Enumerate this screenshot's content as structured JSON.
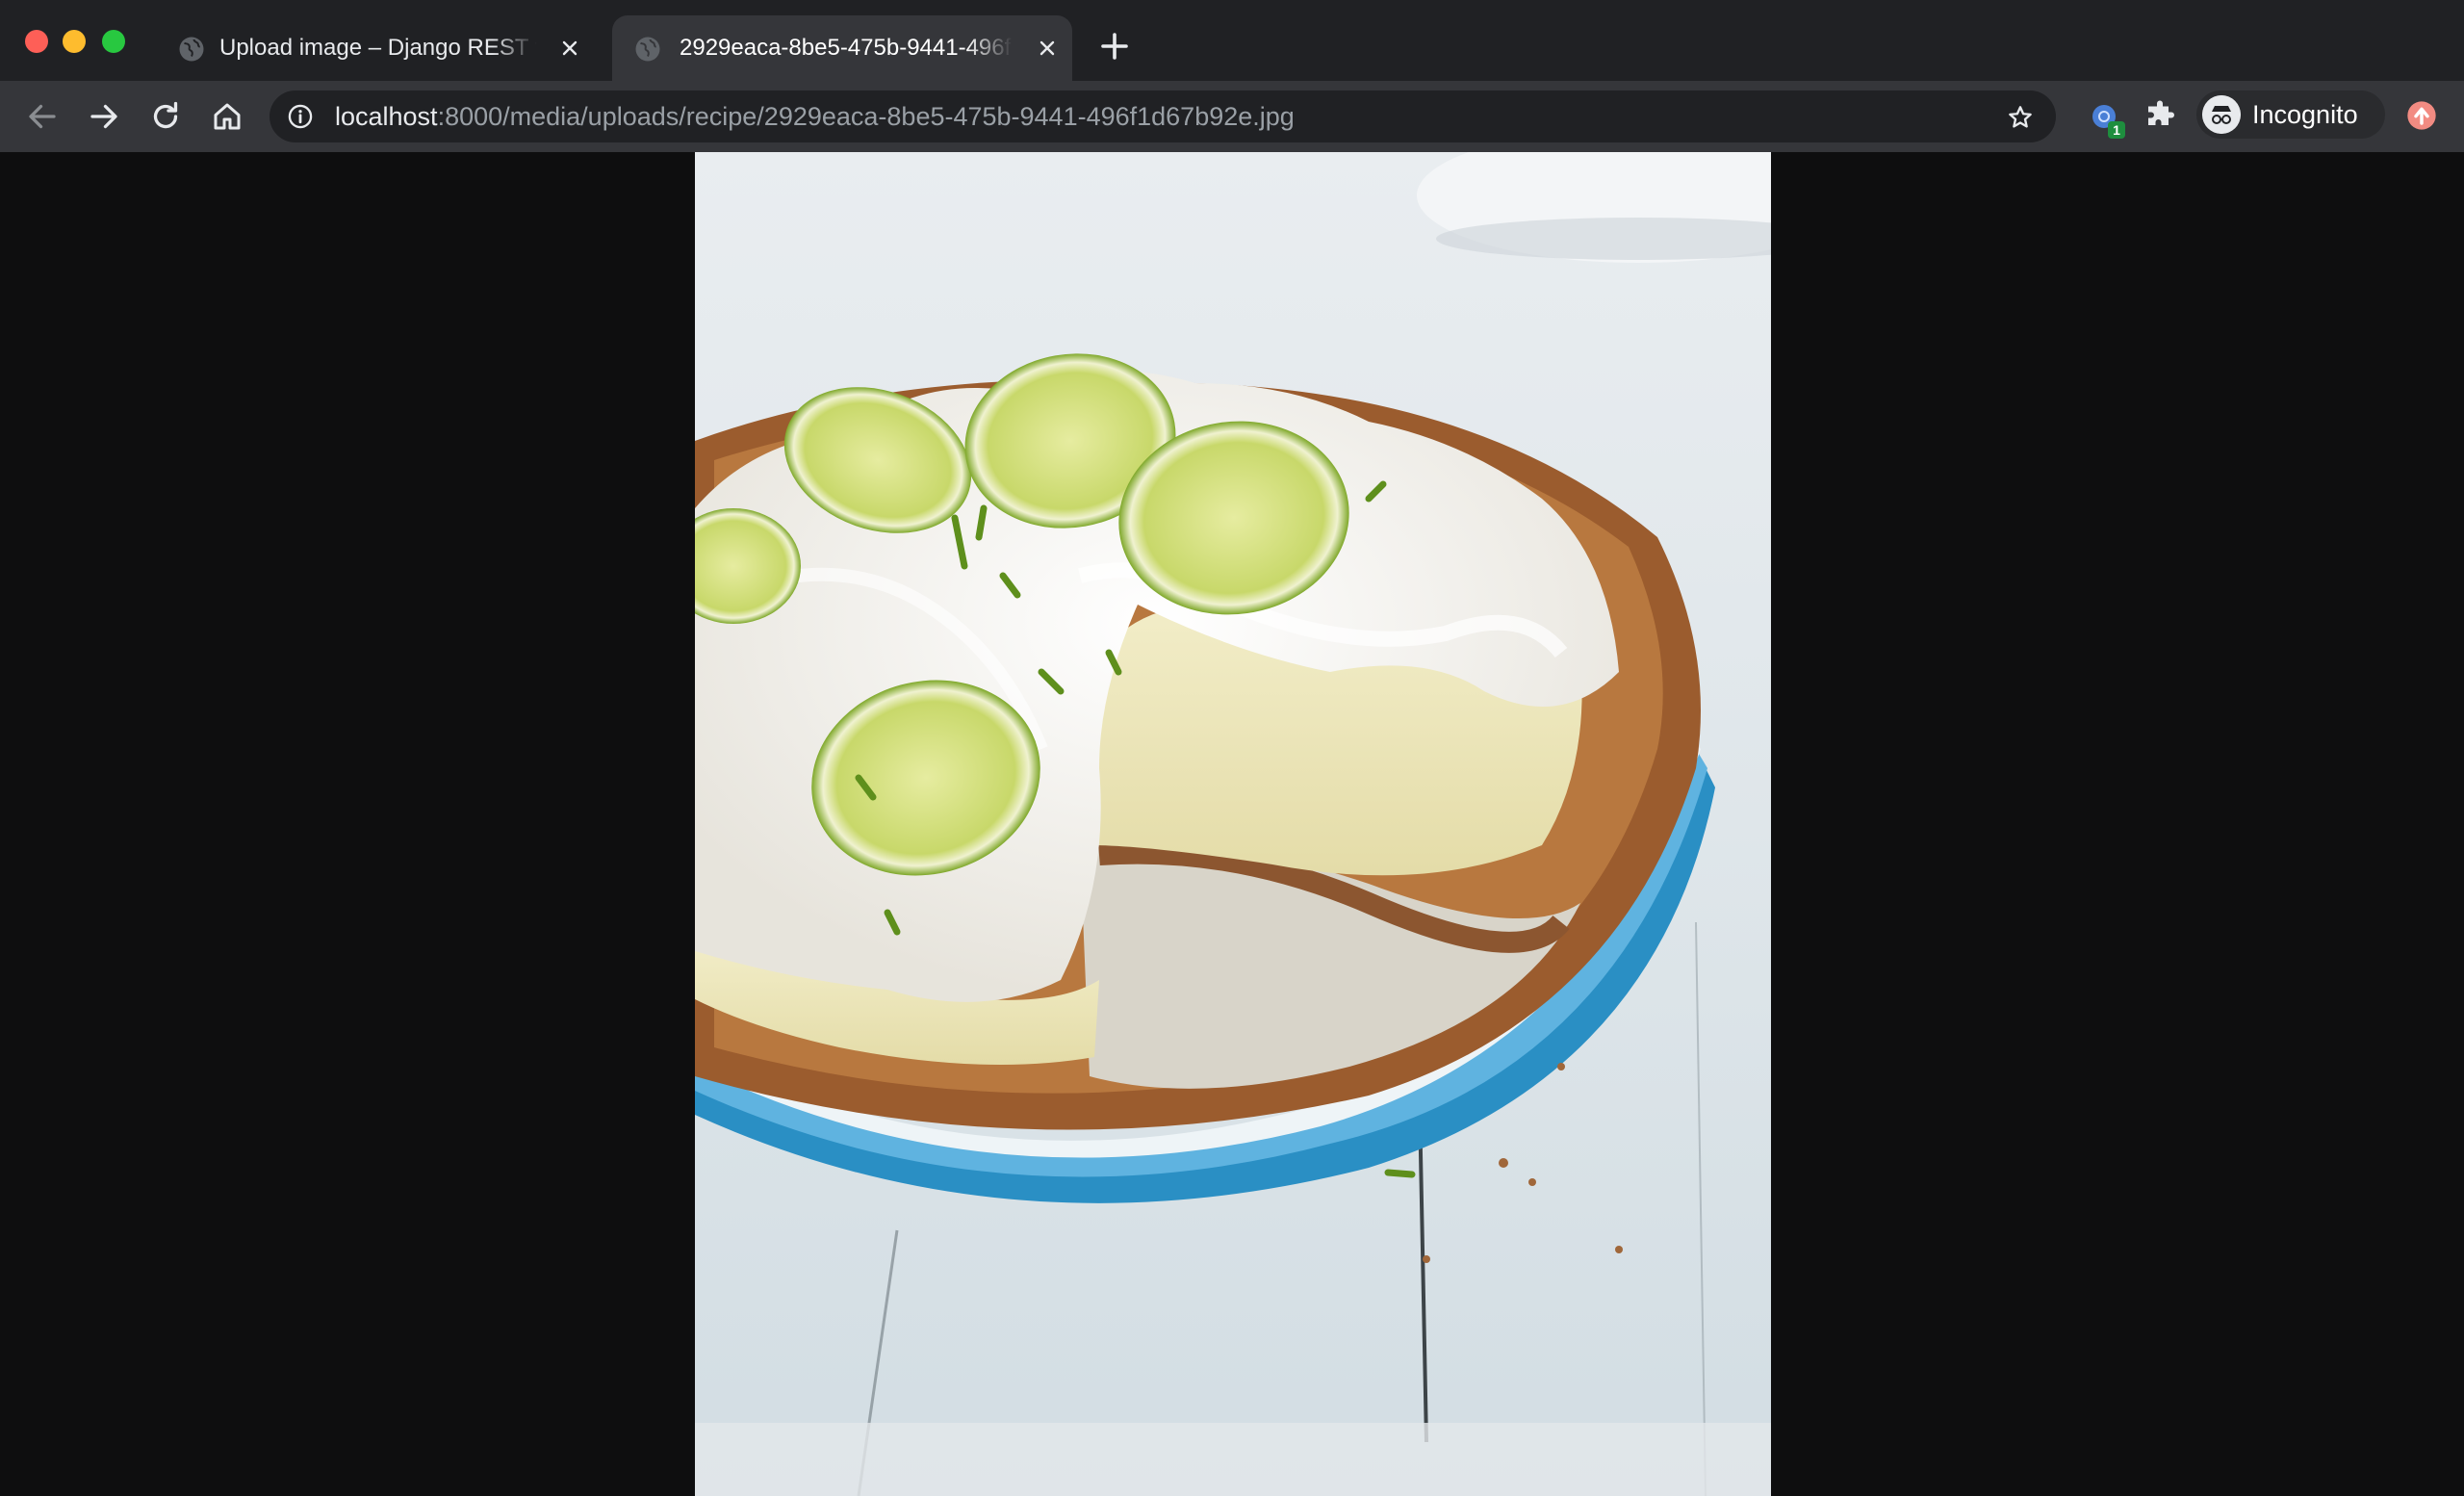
{
  "window": {
    "traffic_lights": [
      "close",
      "minimize",
      "maximize"
    ]
  },
  "tabs": [
    {
      "title": "Upload image – Django REST framework",
      "active": false,
      "favicon": "globe-icon",
      "close_icon": "close-icon"
    },
    {
      "title": "2929eaca-8be5-475b-9441-496f1d67b92e.jpg",
      "active": true,
      "favicon": "globe-icon",
      "close_icon": "close-icon"
    }
  ],
  "new_tab_icon": "plus-icon",
  "toolbar": {
    "back_icon": "arrow-left-icon",
    "forward_icon": "arrow-right-icon",
    "reload_icon": "reload-icon",
    "home_icon": "home-icon",
    "address": {
      "host": "localhost",
      "rest": ":8000/media/uploads/recipe/2929eaca-8be5-475b-9441-496f1d67b92e.jpg",
      "security_icon": "info-icon",
      "bookmark_icon": "star-icon"
    },
    "extension_badge_count": "1",
    "extensions_icon": "puzzle-icon",
    "profile_label": "Incognito",
    "update_icon": "update-arrow-icon"
  },
  "colors": {
    "tabstrip": "#202124",
    "toolbar": "#35363a",
    "omnibox": "#202124",
    "page_background": "#0e0e0f",
    "pie_dish": "#2a8fc4",
    "lime": "#a9c640",
    "whipped_cream": "#f5f3ee",
    "crust": "#9b5c2e"
  },
  "content": {
    "image_subject": "key-lime-pie-photo"
  }
}
